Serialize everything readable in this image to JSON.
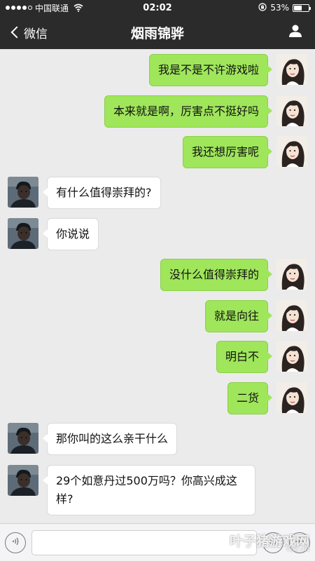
{
  "status_bar": {
    "carrier": "中国联通",
    "time": "02:02",
    "battery": "53%",
    "battery_level": 0.53,
    "icons": [
      "signal-icon",
      "wifi-icon",
      "orientation-lock-icon",
      "battery-icon"
    ]
  },
  "nav": {
    "back_label": "微信",
    "title": "烟雨锦骅",
    "icons": [
      "chevron-left-icon",
      "person-icon"
    ]
  },
  "messages": [
    {
      "side": "right",
      "text": "我是不是不许游戏啦"
    },
    {
      "side": "right",
      "text": "本来就是啊，厉害点不挺好吗"
    },
    {
      "side": "right",
      "text": "我还想厉害呢"
    },
    {
      "side": "left",
      "text": "有什么值得崇拜的?"
    },
    {
      "side": "left",
      "text": "你说说"
    },
    {
      "side": "right",
      "text": "没什么值得崇拜的"
    },
    {
      "side": "right",
      "text": "就是向往"
    },
    {
      "side": "right",
      "text": "明白不"
    },
    {
      "side": "right",
      "text": "二货"
    },
    {
      "side": "left",
      "text": "那你叫的这么亲干什么"
    },
    {
      "side": "left",
      "text": "29个如意丹过500万吗？你高兴成这样?"
    }
  ],
  "input_bar": {
    "icons": [
      "voice-icon",
      "emoji-icon",
      "plus-icon"
    ]
  },
  "watermark": {
    "text": "叶子猪游戏网",
    "sub": "YZZ.CN"
  },
  "colors": {
    "nav_bg": "#2b2b2b",
    "chat_bg": "#ebebeb",
    "bubble_right": "#9fe65b",
    "bubble_left": "#ffffff"
  }
}
